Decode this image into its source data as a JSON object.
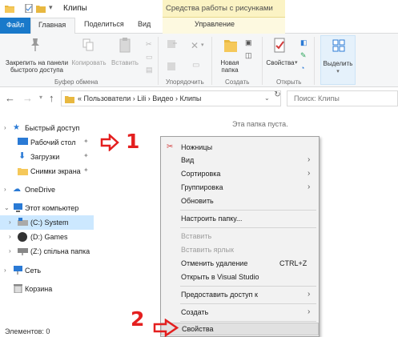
{
  "titlebar": {
    "title": "Клипы",
    "context_tab_header": "Средства работы с рисунками"
  },
  "tabs": {
    "file": "Файл",
    "home": "Главная",
    "share": "Поделиться",
    "view": "Вид",
    "manage": "Управление"
  },
  "ribbon": {
    "pin": "Закрепить на панели быстрого доступа",
    "copy": "Копировать",
    "paste": "Вставить",
    "new_folder": "Новая папка",
    "properties": "Свойства",
    "select": "Выделить",
    "groups": {
      "clipboard": "Буфер обмена",
      "organize": "Упорядочить",
      "create": "Создать",
      "open": "Открыть"
    }
  },
  "address": {
    "crumbs": "« Пользователи › Lili › Видео › Клипы",
    "search_placeholder": "Поиск: Клипы"
  },
  "navpane": {
    "quick_access": "Быстрый доступ",
    "desktop": "Рабочий стол",
    "downloads": "Загрузки",
    "screenshots": "Снимки экрана",
    "onedrive": "OneDrive",
    "this_pc": "Этот компьютер",
    "drive_c": "(C:) System",
    "drive_d": "(D:) Games",
    "drive_z": "(Z:) спільна папка",
    "network": "Сеть",
    "recycle": "Корзина"
  },
  "content": {
    "empty": "Эта папка пуста."
  },
  "status": {
    "items": "Элементов: 0"
  },
  "annotations": {
    "one": "1",
    "two": "2"
  },
  "context_menu": {
    "scissors": "Ножницы",
    "view": "Вид",
    "sort": "Сортировка",
    "group": "Группировка",
    "refresh": "Обновить",
    "customize": "Настроить папку...",
    "paste": "Вставить",
    "paste_shortcut": "Вставить ярлык",
    "undo_delete": "Отменить удаление",
    "undo_shortcut": "CTRL+Z",
    "open_vs": "Открыть в Visual Studio",
    "share_access": "Предоставить доступ к",
    "create": "Создать",
    "properties": "Свойства"
  },
  "colors": {
    "accent": "#1979ca",
    "annotation": "#e41f1f",
    "context_tab": "#fbf3c4"
  }
}
